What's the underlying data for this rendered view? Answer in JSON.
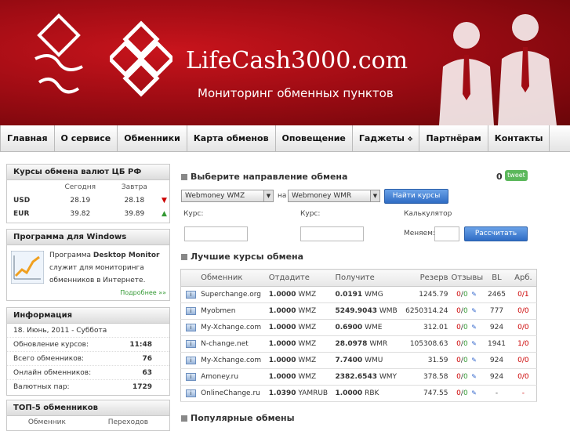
{
  "header": {
    "site_title": "LifeCash3000.com",
    "subtitle": "Мониторинг обменных пунктов"
  },
  "nav": [
    "Главная",
    "О сервисе",
    "Обменники",
    "Карта обменов",
    "Оповещение",
    "Гаджеты",
    "Партнёрам",
    "Контакты"
  ],
  "cbr": {
    "title": "Курсы обмена валют ЦБ РФ",
    "col_today": "Сегодня",
    "col_tomorrow": "Завтра",
    "rows": [
      {
        "cur": "USD",
        "today": "28.19",
        "tomorrow": "28.18",
        "trend": "down"
      },
      {
        "cur": "EUR",
        "today": "39.82",
        "tomorrow": "39.89",
        "trend": "up"
      }
    ]
  },
  "program": {
    "title": "Программа для Windows",
    "text_pre": "Программа ",
    "text_bold": "Desktop Monitor",
    "text_post": " служит для мониторинга обменников в Интернете.",
    "more": "Подробнее »»"
  },
  "info": {
    "title": "Информация",
    "date": "18. Июнь, 2011 - Суббота",
    "rows": [
      {
        "label": "Обновление курсов:",
        "value": "11:48"
      },
      {
        "label": "Всего обменников:",
        "value": "76"
      },
      {
        "label": "Онлайн обменников:",
        "value": "63"
      },
      {
        "label": "Валютных пар:",
        "value": "1729"
      }
    ]
  },
  "top5": {
    "title": "ТОП-5 обменников",
    "col1": "Обменник",
    "col2": "Переходов"
  },
  "direction": {
    "title": "Выберите направление обмена",
    "from": "Webmoney WMZ",
    "on": "на",
    "to": "Webmoney WMR",
    "find_button": "Найти курсы",
    "tweet_count": "0",
    "tweet_label": "tweet"
  },
  "calc": {
    "kurs1": "Курс:",
    "kurs2": "Курс:",
    "calculator": "Калькулятор",
    "menyaem": "Меняем:",
    "calc_button": "Рассчитать"
  },
  "best": {
    "title": "Лучшие курсы обмена",
    "headers": [
      "Обменник",
      "Отдадите",
      "Получите",
      "Резерв",
      "Отзывы",
      "BL",
      "Арб."
    ],
    "rows": [
      {
        "name": "Superchange.org",
        "give": "1.0000",
        "give_cur": "WMZ",
        "get": "0.0191",
        "get_cur": "WMG",
        "reserve": "1245.79",
        "rev_neg": "0",
        "rev_pos": "0",
        "bl": "2465",
        "arb": "0/1"
      },
      {
        "name": "Myobmen",
        "give": "1.0000",
        "give_cur": "WMZ",
        "get": "5249.9043",
        "get_cur": "WMB",
        "reserve": "6250314.24",
        "rev_neg": "0",
        "rev_pos": "0",
        "bl": "777",
        "arb": "0/0"
      },
      {
        "name": "My-Xchange.com",
        "give": "1.0000",
        "give_cur": "WMZ",
        "get": "0.6900",
        "get_cur": "WME",
        "reserve": "312.01",
        "rev_neg": "0",
        "rev_pos": "0",
        "bl": "924",
        "arb": "0/0"
      },
      {
        "name": "N-change.net",
        "give": "1.0000",
        "give_cur": "WMZ",
        "get": "28.0978",
        "get_cur": "WMR",
        "reserve": "105308.63",
        "rev_neg": "0",
        "rev_pos": "0",
        "bl": "1941",
        "arb": "1/0"
      },
      {
        "name": "My-Xchange.com",
        "give": "1.0000",
        "give_cur": "WMZ",
        "get": "7.7400",
        "get_cur": "WMU",
        "reserve": "31.59",
        "rev_neg": "0",
        "rev_pos": "0",
        "bl": "924",
        "arb": "0/0"
      },
      {
        "name": "Amoney.ru",
        "give": "1.0000",
        "give_cur": "WMZ",
        "get": "2382.6543",
        "get_cur": "WMY",
        "reserve": "378.58",
        "rev_neg": "0",
        "rev_pos": "0",
        "bl": "924",
        "arb": "0/0"
      },
      {
        "name": "OnlineChange.ru",
        "give": "1.0390",
        "give_cur": "YAMRUB",
        "get": "1.0000",
        "get_cur": "RBK",
        "reserve": "747.55",
        "rev_neg": "0",
        "rev_pos": "0",
        "bl": "-",
        "arb": "-"
      }
    ]
  },
  "popular": {
    "title": "Популярные обмены"
  },
  "colors": {
    "brand_red": "#b0101a",
    "button_blue": "#3d7bd0",
    "tweet_green": "#5cb85c"
  },
  "icons": [
    "info-icon",
    "feedback-icon",
    "down-arrow-icon",
    "up-arrow-icon",
    "chart-icon",
    "gadget-icon"
  ]
}
